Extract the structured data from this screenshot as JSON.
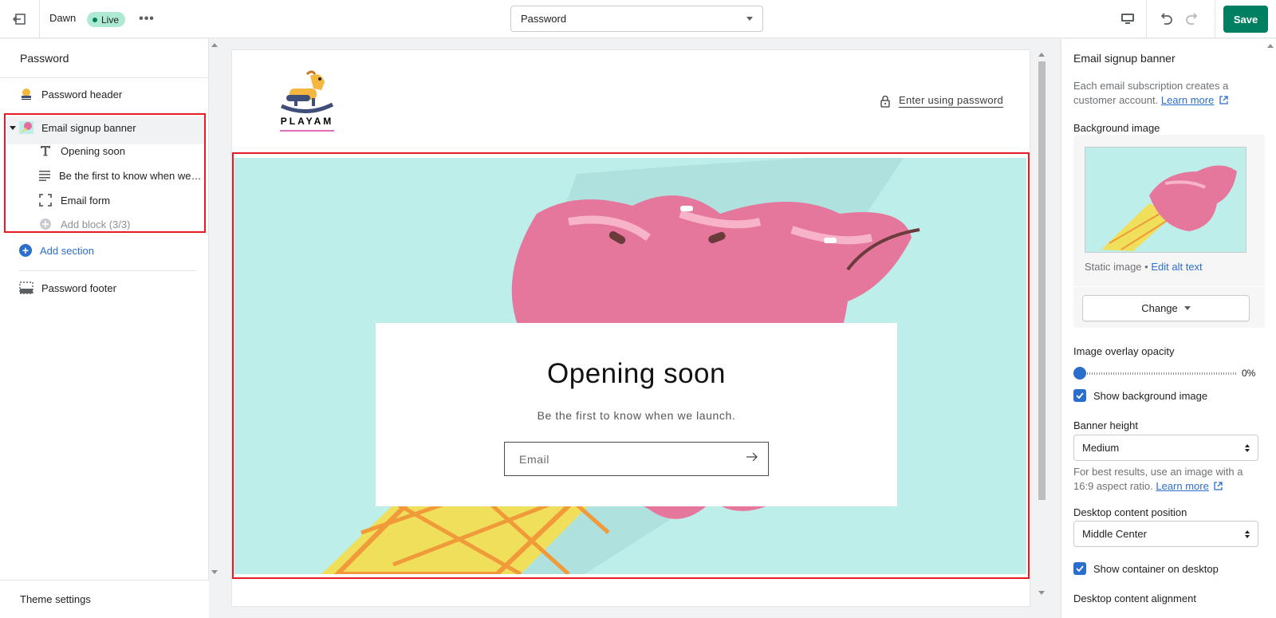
{
  "topbar": {
    "theme_name": "Dawn",
    "status_badge": "Live",
    "page_selector_value": "Password",
    "save_label": "Save"
  },
  "sidebar": {
    "title": "Password",
    "sections": {
      "header": "Password header",
      "banner": "Email signup banner",
      "footer": "Password footer"
    },
    "blocks": [
      {
        "label": "Opening soon",
        "icon": "text-icon"
      },
      {
        "label": "Be the first to know when we launch.",
        "icon": "paragraph-icon"
      },
      {
        "label": "Email form",
        "icon": "form-icon"
      }
    ],
    "add_block": "Add block (3/3)",
    "add_section": "Add section",
    "theme_settings": "Theme settings"
  },
  "preview": {
    "logo_text": "PLAYAM",
    "enter_password": "Enter using password",
    "banner_title": "Opening soon",
    "banner_subtitle": "Be the first to know when we launch.",
    "email_placeholder": "Email"
  },
  "settings": {
    "title": "Email signup banner",
    "description": "Each email subscription creates a customer account.",
    "learn_more": "Learn more",
    "background_image_label": "Background image",
    "static_image": "Static image",
    "separator": "•",
    "edit_alt_text": "Edit alt text",
    "change_label": "Change",
    "overlay_label": "Image overlay opacity",
    "overlay_value": "0%",
    "overlay_fraction": 0,
    "show_bg_label": "Show background image",
    "show_bg_checked": true,
    "banner_height_label": "Banner height",
    "banner_height_value": "Medium",
    "banner_help": "For best results, use an image with a 16:9 aspect ratio.",
    "desktop_position_label": "Desktop content position",
    "desktop_position_value": "Middle Center",
    "show_container_label": "Show container on desktop",
    "show_container_checked": true,
    "desktop_alignment_label": "Desktop content alignment"
  },
  "colors": {
    "accent": "#2c6ecb",
    "save_button": "#008060",
    "live_badge": "#aee9d1",
    "selection_outline": "#e51c23",
    "banner_background": "#bdeee9"
  }
}
